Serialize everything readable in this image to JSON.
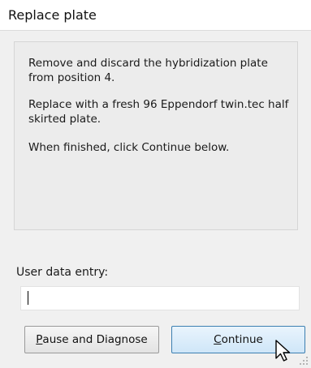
{
  "window": {
    "title": "Replace plate"
  },
  "message": {
    "line1": "Remove and discard the hybridization plate from position 4.",
    "line2": "Replace with a fresh 96 Eppendorf twin.tec half skirted plate.",
    "line3": "When finished, click Continue below."
  },
  "entry": {
    "label": "User data entry:",
    "value": "",
    "placeholder": ""
  },
  "buttons": {
    "pause": {
      "mnemonic": "P",
      "rest": "ause and Diagnose"
    },
    "continue": {
      "mnemonic": "C",
      "rest": "ontinue"
    }
  },
  "icons": {
    "cursor": "arrow-pointer-icon",
    "grip": "resize-grip-icon"
  },
  "colors": {
    "continue_border": "#3c7fb1",
    "continue_fill": "#cfe6f8",
    "panel_bg": "#ececec"
  }
}
